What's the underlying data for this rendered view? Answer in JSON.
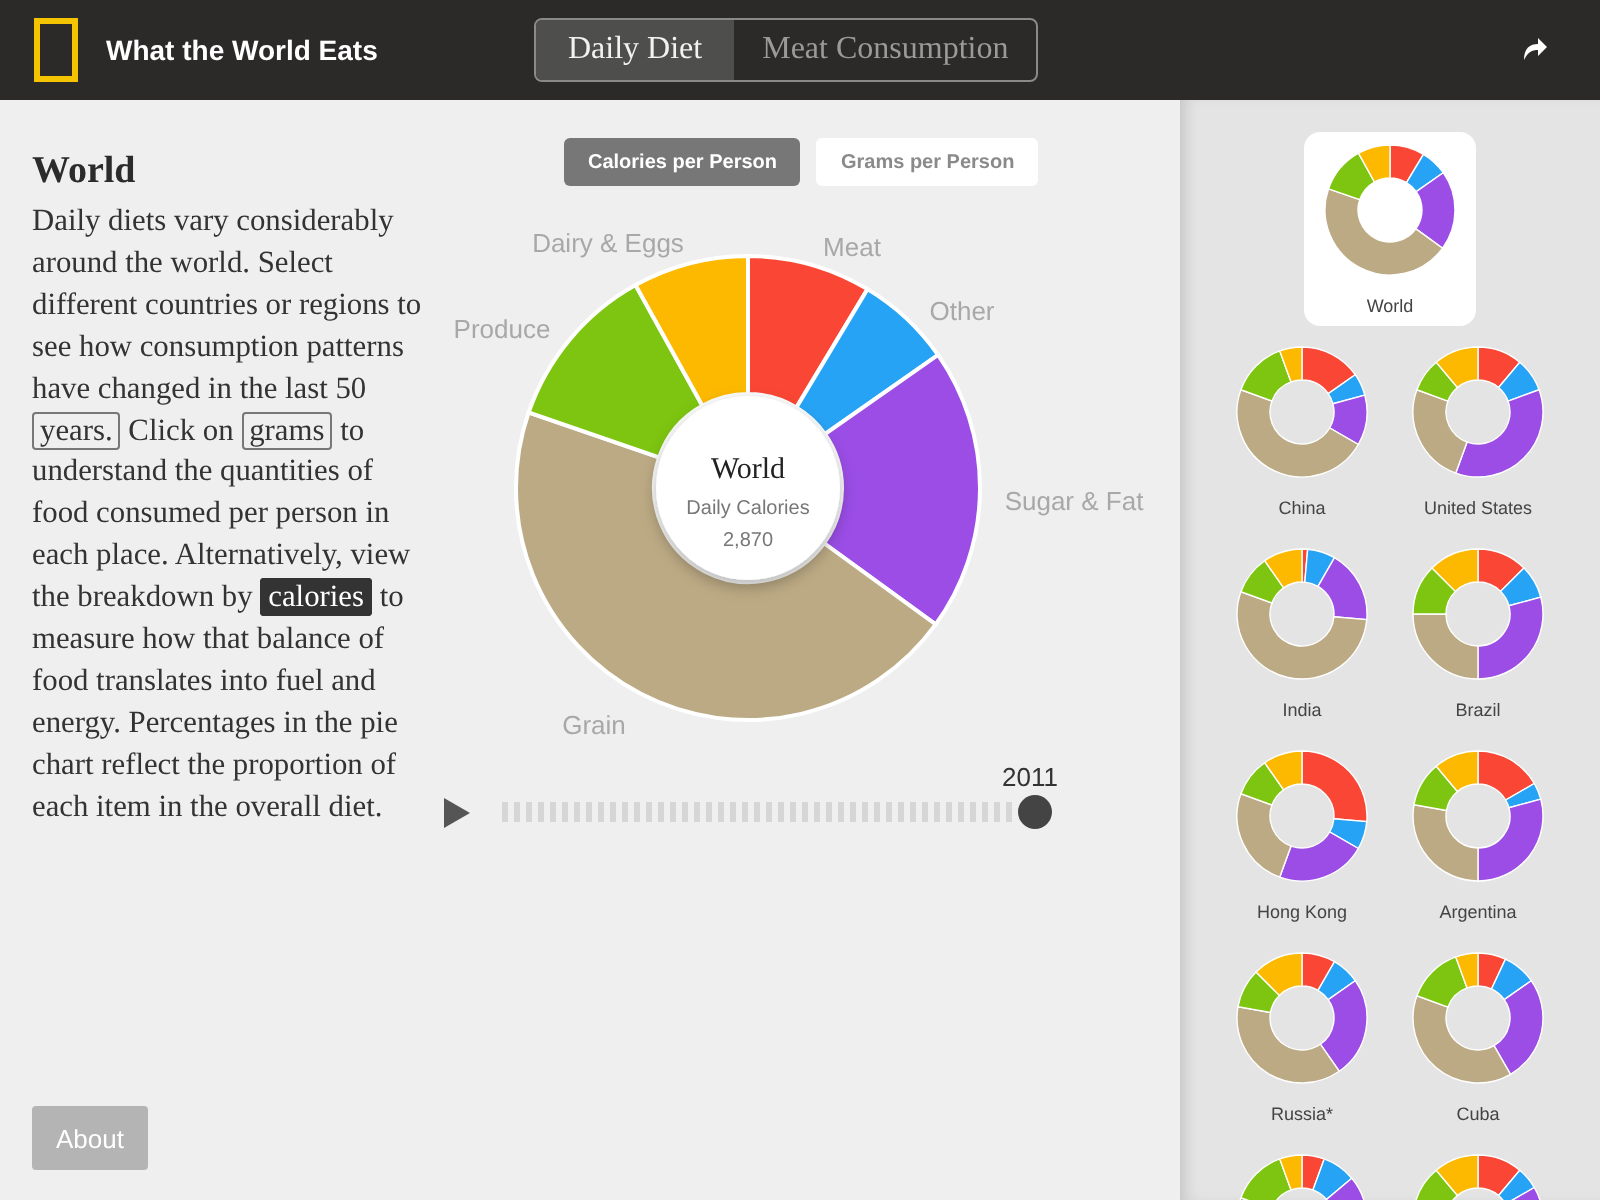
{
  "header": {
    "title": "What the World Eats",
    "tabs": [
      {
        "label": "Daily Diet",
        "selected": true
      },
      {
        "label": "Meat Consumption",
        "selected": false
      }
    ]
  },
  "intro": {
    "heading": "World",
    "segments": [
      {
        "kind": "text",
        "text": "Daily diets vary considerably around the world. Select different countries or regions to see how consumption patterns have changed in the last 50 "
      },
      {
        "kind": "link",
        "text": "years.",
        "selected": false
      },
      {
        "kind": "text",
        "text": " Click on "
      },
      {
        "kind": "link",
        "text": "grams",
        "selected": false
      },
      {
        "kind": "text",
        "text": " to understand the quantities of food consumed per person in each place. Alternatively, view the breakdown by "
      },
      {
        "kind": "link",
        "text": "calories",
        "selected": true
      },
      {
        "kind": "text",
        "text": " to measure how that balance of food translates into fuel and energy. Percentages in the pie chart reflect the proportion of each item in the overall diet."
      }
    ]
  },
  "about_button": "About",
  "units": [
    {
      "label": "Calories per Person",
      "selected": true
    },
    {
      "label": "Grams per Person",
      "selected": false
    }
  ],
  "chart": {
    "center_title": "World",
    "center_label": "Daily Calories",
    "center_value": "2,870",
    "slices": [
      {
        "label": "Meat",
        "color": "#fa4634"
      },
      {
        "label": "Other",
        "color": "#27a3f5"
      },
      {
        "label": "Sugar & Fat",
        "color": "#9b4de6"
      },
      {
        "label": "Grain",
        "color": "#bcaa84"
      },
      {
        "label": "Produce",
        "color": "#7dc510"
      },
      {
        "label": "Dairy & Eggs",
        "color": "#fdb900"
      }
    ]
  },
  "timeline": {
    "year": "2011",
    "level": 1
  },
  "countries": [
    {
      "name": "World",
      "selected": true
    },
    {
      "name": "China",
      "selected": false
    },
    {
      "name": "United States",
      "selected": false
    },
    {
      "name": "India",
      "selected": false
    },
    {
      "name": "Brazil",
      "selected": false
    },
    {
      "name": "Hong Kong",
      "selected": false
    },
    {
      "name": "Argentina",
      "selected": false
    },
    {
      "name": "Russia*",
      "selected": false
    },
    {
      "name": "Cuba",
      "selected": false
    }
  ]
}
